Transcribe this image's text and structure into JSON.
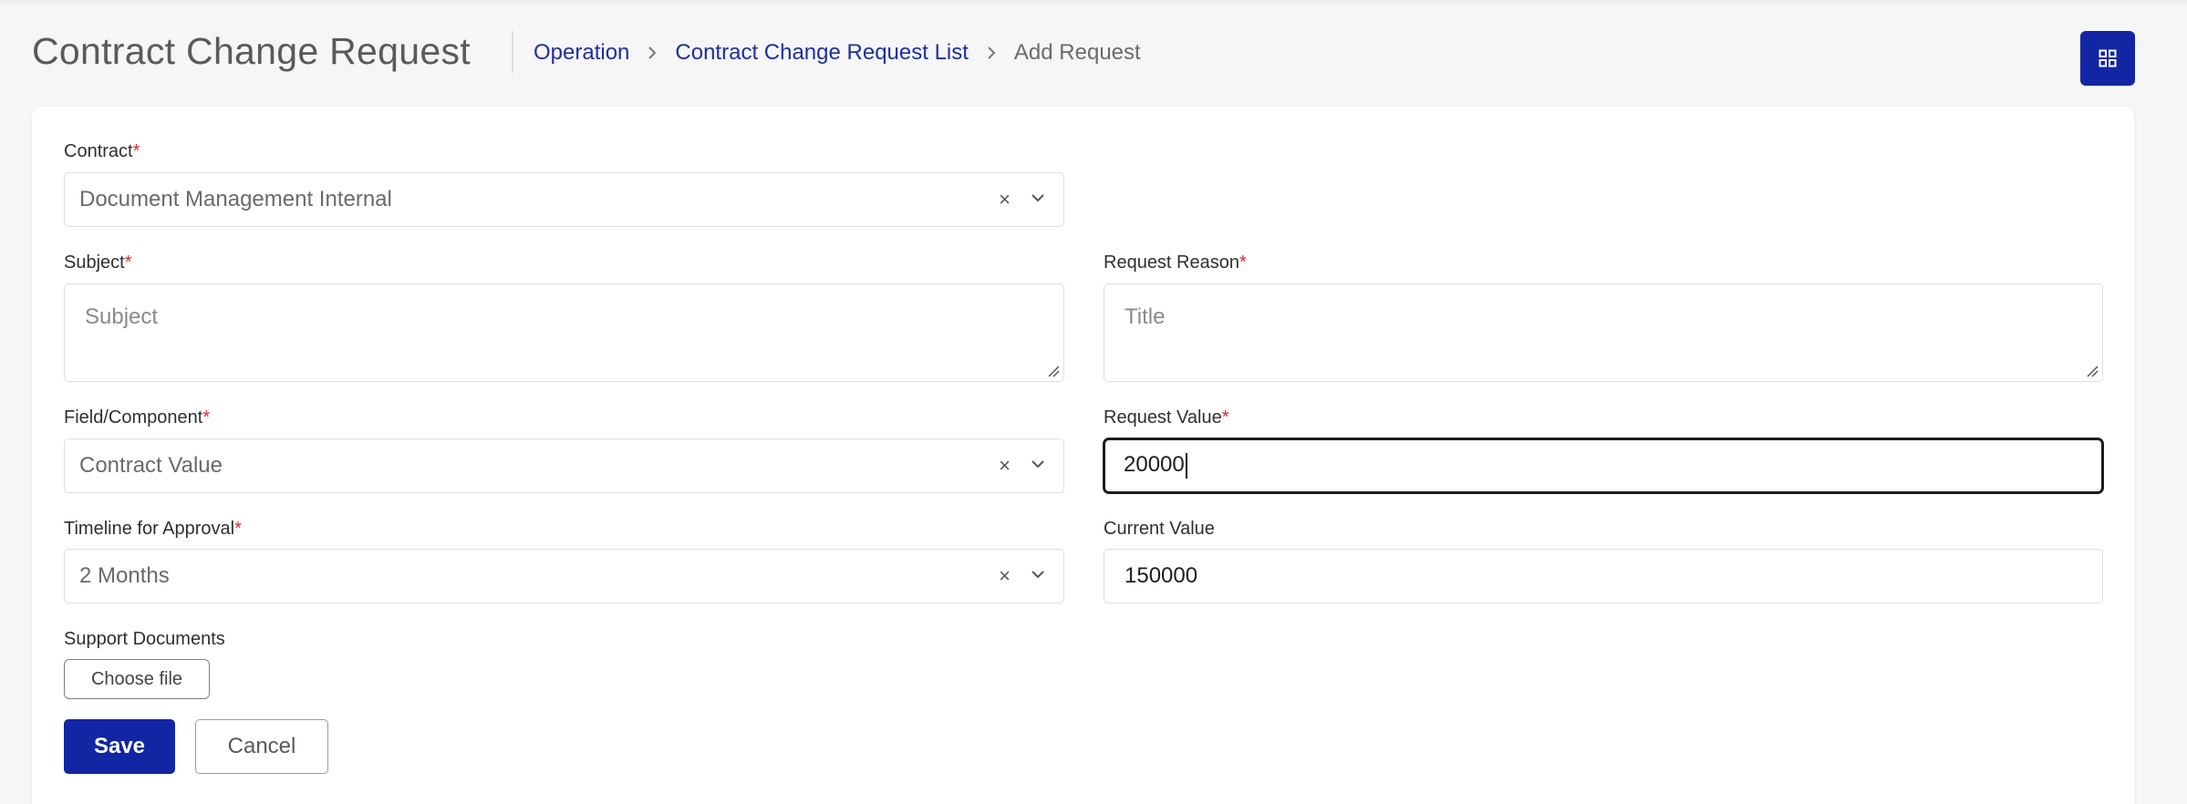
{
  "header": {
    "title": "Contract Change Request",
    "breadcrumb": [
      {
        "label": "Operation"
      },
      {
        "label": "Contract Change Request List"
      },
      {
        "label": "Add Request"
      }
    ]
  },
  "icons": {
    "apps": "grid-icon",
    "separator": "chevron-right-icon",
    "clear": "close-icon",
    "dropdown": "chevron-down-icon",
    "resize": "resize-handle-icon"
  },
  "form": {
    "contract": {
      "label": "Contract",
      "value": "Document Management Internal",
      "clear": "×"
    },
    "subject": {
      "label": "Subject",
      "placeholder": "Subject"
    },
    "request_reason": {
      "label": "Request Reason",
      "placeholder": "Title"
    },
    "field_component": {
      "label": "Field/Component",
      "value": "Contract Value",
      "clear": "×"
    },
    "request_value": {
      "label": "Request Value",
      "value": "20000"
    },
    "timeline": {
      "label": "Timeline for Approval",
      "value": "2 Months",
      "clear": "×"
    },
    "current_value": {
      "label": "Current Value",
      "value": "150000"
    },
    "support_documents": {
      "label": "Support Documents",
      "button": "Choose file"
    },
    "required_marker": "*"
  },
  "actions": {
    "save": "Save",
    "cancel": "Cancel"
  },
  "colors": {
    "primary": "#1226a4",
    "link": "#1f2f9c",
    "required": "#e0282e",
    "background": "#f6f6f7"
  }
}
